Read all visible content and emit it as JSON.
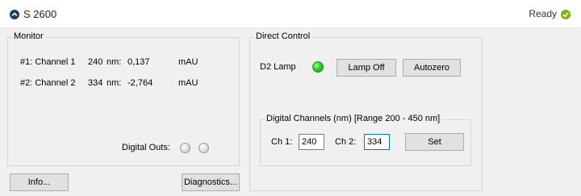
{
  "header": {
    "title": "S 2600",
    "status": "Ready"
  },
  "monitor": {
    "legend": "Monitor",
    "rows": [
      {
        "channel": "#1: Channel 1",
        "wavelength": "240",
        "nm": "nm:",
        "value": "0,137",
        "unit": "mAU"
      },
      {
        "channel": "#2: Channel 2",
        "wavelength": "334",
        "nm": "nm:",
        "value": "-2,764",
        "unit": "mAU"
      }
    ],
    "digital_outs_label": "Digital Outs:"
  },
  "buttons": {
    "info": "Info...",
    "diagnostics": "Diagnostics..."
  },
  "direct_control": {
    "legend": "Direct Control",
    "lamp_label": "D2 Lamp",
    "lamp_off": "Lamp Off",
    "autozero": "Autozero",
    "digital_channels": {
      "legend": "Digital Channels (nm) [Range 200 - 450 nm]",
      "ch1_label": "Ch 1:",
      "ch1_value": "240",
      "ch2_label": "Ch 2:",
      "ch2_value": "334",
      "set": "Set"
    }
  },
  "colors": {
    "lamp_on": "#2ecc2e",
    "status_ok": "#7ab800",
    "header_icon": "#1f3f66",
    "focus": "#0078d7"
  },
  "icons": {
    "header": "chevron-up-icon",
    "status": "check-icon"
  }
}
